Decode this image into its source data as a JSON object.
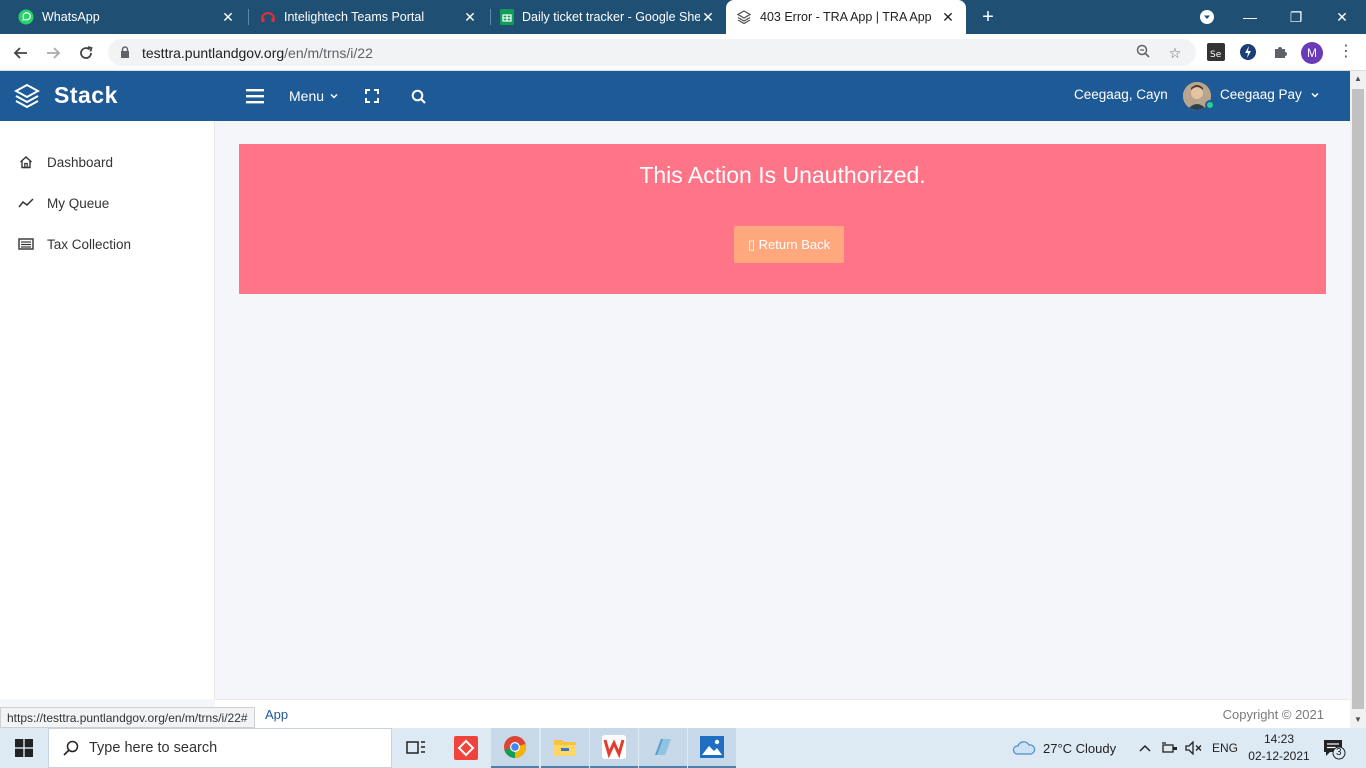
{
  "browser": {
    "tabs": [
      {
        "title": "WhatsApp",
        "icon": "whatsapp-icon"
      },
      {
        "title": "Intelightech Teams Portal",
        "icon": "headset-icon"
      },
      {
        "title": "Daily ticket tracker - Google Shee",
        "icon": "google-sheets-icon"
      },
      {
        "title": "403 Error - TRA App | TRA App",
        "icon": "stack-logo-icon"
      }
    ],
    "url_host": "testtra.puntlandgov.org",
    "url_path": "/en/m/trns/i/22",
    "profile_initial": "M",
    "status_url": "https://testtra.puntlandgov.org/en/m/trns/i/22#"
  },
  "header": {
    "brand": "Stack",
    "menu_label": "Menu",
    "user_short": "Ceegaag, Cayn",
    "user_name": "Ceegaag Pay"
  },
  "sidebar": {
    "items": [
      {
        "label": "Dashboard",
        "icon": "home-icon"
      },
      {
        "label": "My Queue",
        "icon": "trend-line-icon"
      },
      {
        "label": "Tax Collection",
        "icon": "list-box-icon"
      }
    ]
  },
  "alert": {
    "title": "This Action Is Unauthorized.",
    "button_label": "▯ Return Back"
  },
  "footer": {
    "left": "App",
    "right": "Copyright © 2021"
  },
  "taskbar": {
    "search_placeholder": "Type here to search",
    "weather": "27°C  Cloudy",
    "lang": "ENG",
    "time": "14:23",
    "date": "02-12-2021",
    "notifications": "3"
  },
  "colors": {
    "header_bg": "#1e5a96",
    "alert_bg": "#ff7588",
    "button_bg": "#ffa87d"
  }
}
